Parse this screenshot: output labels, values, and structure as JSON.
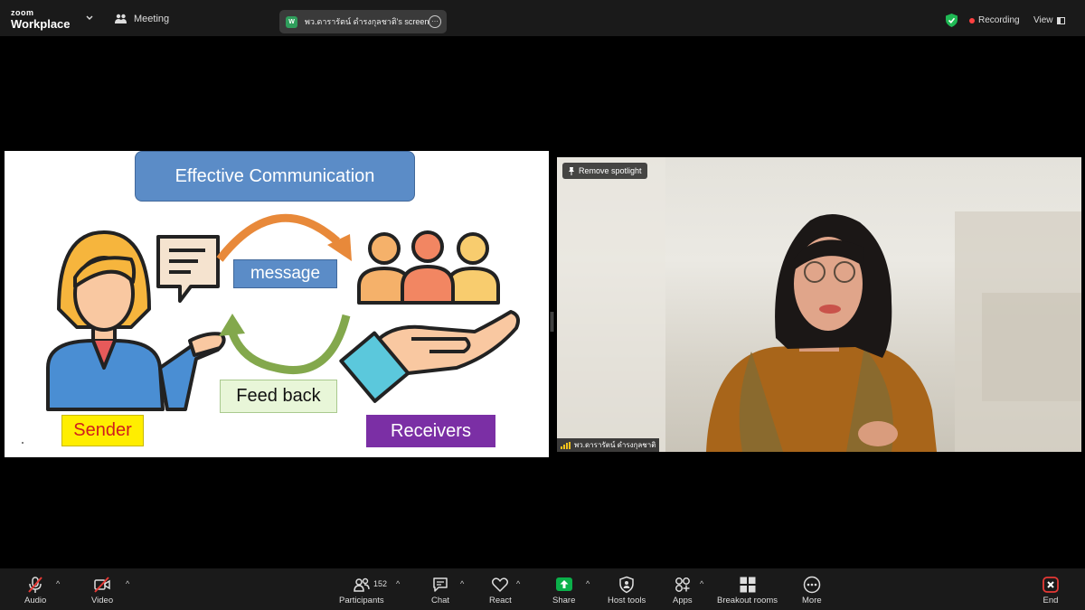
{
  "app": {
    "brand_small": "zoom",
    "brand_name": "Workplace",
    "meeting_label": "Meeting",
    "share_initials": "W",
    "share_label": "พว.ดารารัตน์ ดำรงกุลชาติ's screen",
    "recording_label": "Recording",
    "view_label": "View"
  },
  "slide": {
    "title": "Effective Communication",
    "message": "message",
    "feedback": "Feed back",
    "sender": "Sender",
    "receivers": "Receivers"
  },
  "video": {
    "spotlight_label": "Remove spotlight",
    "participant_name": "พว.ดารารัตน์ ดำรงกุลชาติ"
  },
  "toolbar": {
    "audio": "Audio",
    "video": "Video",
    "participants": "Participants",
    "participants_count": "152",
    "chat": "Chat",
    "react": "React",
    "share": "Share",
    "host_tools": "Host tools",
    "apps": "Apps",
    "breakout_rooms": "Breakout rooms",
    "more": "More",
    "end": "End"
  },
  "colors": {
    "share_green": "#0bb04a",
    "end_red": "#e53935",
    "recording_red": "#ff4040",
    "slide_blue": "#5b8cc7",
    "receivers_purple": "#7b2fa5",
    "sender_yellow": "#ffee00"
  }
}
